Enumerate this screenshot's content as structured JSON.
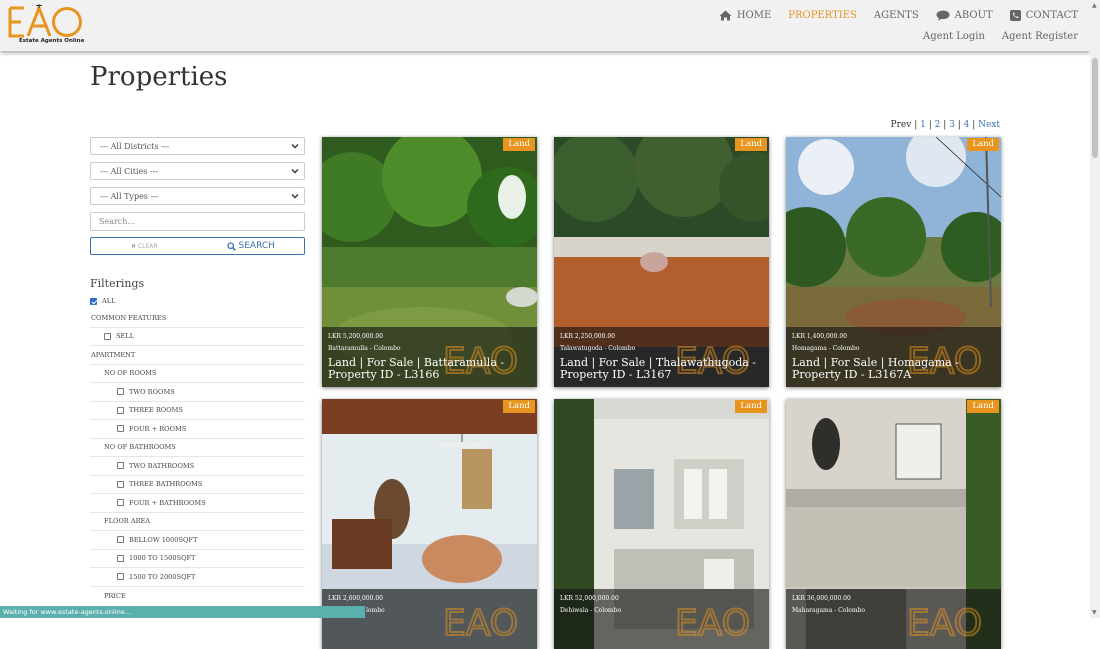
{
  "brand": {
    "logo_text": "EAO",
    "tagline": "Estate Agents Online",
    "accent_color": "#e8951f"
  },
  "nav": {
    "items": [
      {
        "label": "HOME",
        "icon": "home-icon"
      },
      {
        "label": "PROPERTIES",
        "icon": ""
      },
      {
        "label": "AGENTS",
        "icon": ""
      },
      {
        "label": "ABOUT",
        "icon": "comment-icon"
      },
      {
        "label": "CONTACT",
        "icon": "phone-icon"
      }
    ],
    "active": "PROPERTIES",
    "agent_login": "Agent Login",
    "agent_register": "Agent Register"
  },
  "page": {
    "title": "Properties"
  },
  "pagination": {
    "prev": "Prev",
    "pages": [
      "1",
      "2",
      "3",
      "4"
    ],
    "next": "Next"
  },
  "search": {
    "district": "--- All Districts ---",
    "city": "--- All Cities ---",
    "type": "--- All Types ---",
    "placeholder": "Search...",
    "clear_label": "✖ CLEAR",
    "search_label": "SEARCH"
  },
  "filters": {
    "title": "Filterings",
    "all_label": "ALL",
    "common_features": "COMMON FEATURES",
    "sell": "SELL",
    "apartment": "APARTMENT",
    "no_of_rooms": "NO OF ROOMS",
    "two_rooms": "TWO ROOMS",
    "three_rooms": "THREE ROOMS",
    "four_rooms": "FOUR + ROOMS",
    "no_of_bathrooms": "NO OF BATHROOMS",
    "two_bathrooms": "TWO BATHROOMS",
    "three_bathrooms": "THREE BATHROOMS",
    "four_bathrooms": "FOUR + BATHROOMS",
    "floor_area": "FLOOR AREA",
    "bellow_1000": "BELLOW 1000SQFT",
    "r1000_1500": "1000 TO 1500SQFT",
    "r1500_2000": "1500 TO 2000SQFT",
    "price": "PRICE"
  },
  "listings": [
    {
      "badge": "Land",
      "price": "LKR 5,200,000.00",
      "location": "Battaramulla - Colombo",
      "title": "Land | For Sale | Battaramulla - Property ID - L3166"
    },
    {
      "badge": "Land",
      "price": "LKR 2,250,000.00",
      "location": "Talawatugoda - Colombo",
      "title": "Land | For Sale | Thalawathugoda - Property ID - L3167"
    },
    {
      "badge": "Land",
      "price": "LKR 1,400,000.00",
      "location": "Homagama - Colombo",
      "title": "Land | For Sale | Homagama - Property ID - L3167A"
    },
    {
      "badge": "Land",
      "price": "LKR 2,600,000.00",
      "location": "lombo",
      "title": ""
    },
    {
      "badge": "Land",
      "price": "LKR 52,000,000.00",
      "location": "Dehiwala - Colombo",
      "title": ""
    },
    {
      "badge": "Land",
      "price": "LKR 36,000,000.00",
      "location": "Maharagama - Colombo",
      "title": ""
    }
  ],
  "status": {
    "text": "Waiting for www.estate-agents.online..."
  }
}
